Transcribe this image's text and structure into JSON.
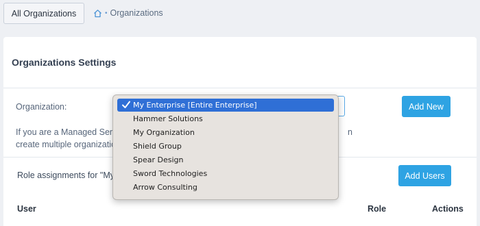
{
  "topbar": {
    "all_orgs_label": "All Organizations",
    "breadcrumb_label": "Organizations",
    "breadcrumb_sep": "•"
  },
  "card": {
    "title": "Organizations Settings",
    "org_label": "Organization:",
    "add_new_label": "Add New",
    "help_line1": "If you are a Managed Servi",
    "help_line1_end": "n",
    "help_line2": "create multiple organizatio",
    "role_assign_text": "Role assignments for \"My E",
    "add_users_label": "Add Users",
    "columns": {
      "user": "User",
      "role": "Role",
      "actions": "Actions"
    }
  },
  "dropdown": {
    "selected_index": 0,
    "options": [
      "My Enterprise [Entire Enterprise]",
      "Hammer Solutions",
      "My Organization",
      "Shield Group",
      "Spear Design",
      "Sword Technologies",
      "Arrow Consulting"
    ]
  },
  "colors": {
    "accent": "#2ea3e3",
    "selection": "#2f6fd6"
  }
}
